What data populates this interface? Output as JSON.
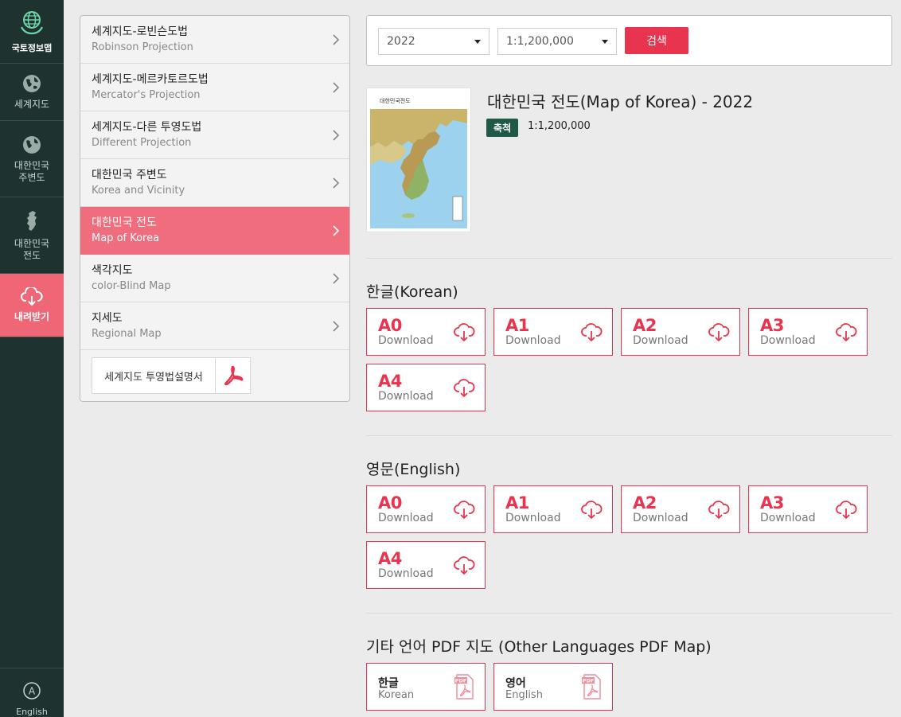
{
  "rail": {
    "logo": "국토정보맵",
    "items": [
      {
        "label": "세계지도"
      },
      {
        "label": "대한민국\n주변도"
      },
      {
        "label": "대한민국\n전도"
      },
      {
        "label": "내려받기"
      }
    ],
    "bottom": "English"
  },
  "menu": {
    "items": [
      {
        "ko": "세계지도-로빈슨도법",
        "en": "Robinson Projection"
      },
      {
        "ko": "세계지도-메르카토르도법",
        "en": "Mercator's Projection"
      },
      {
        "ko": "세계지도-다른 투영도법",
        "en": "Different Projection"
      },
      {
        "ko": "대한민국 주변도",
        "en": "Korea and Vicinity"
      },
      {
        "ko": "대한민국 전도",
        "en": "Map of Korea"
      },
      {
        "ko": "색각지도",
        "en": "color-Blind Map"
      },
      {
        "ko": "지세도",
        "en": "Regional Map"
      }
    ],
    "guide_label": "세계지도 투영법설명서"
  },
  "search": {
    "year": "2022",
    "scale": "1:1,200,000",
    "button": "검색"
  },
  "map": {
    "thumb_caption": "대한민국전도",
    "title": "대한민국 전도(Map of Korea) - 2022",
    "scale_badge": "축척",
    "scale_value": "1:1,200,000"
  },
  "sections": {
    "korean": {
      "title": "한글(Korean)",
      "sizes": [
        "A0",
        "A1",
        "A2",
        "A3",
        "A4"
      ]
    },
    "english": {
      "title": "영문(English)",
      "sizes": [
        "A0",
        "A1",
        "A2",
        "A3",
        "A4"
      ]
    },
    "other": {
      "title": "기타 언어 PDF 지도 (Other Languages PDF Map)",
      "buttons": [
        {
          "ko": "한글",
          "en": "Korean"
        },
        {
          "ko": "영어",
          "en": "English"
        }
      ]
    },
    "download_label": "Download"
  },
  "colors": {
    "rail_bg": "#1e3330",
    "accent": "#e8344e",
    "active_menu": "#f06d7e",
    "badge": "#1e5a47"
  }
}
